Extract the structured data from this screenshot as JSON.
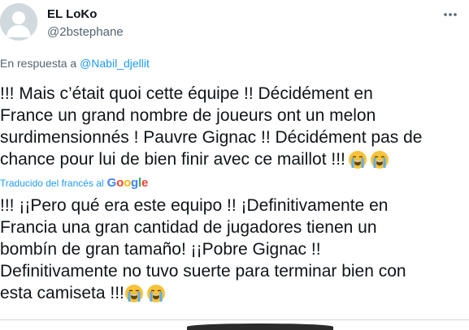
{
  "author": {
    "name": "EL LoKo",
    "handle": "@2bstephane"
  },
  "reply": {
    "prefix": "En respuesta a",
    "mention": "@Nabil_djellit"
  },
  "tweet": {
    "lines": [
      "!!! Mais c’était quoi cette équipe !! Décidément en",
      "France un grand nombre de joueurs ont un melon",
      "surdimensionnés ! Pauvre Gignac !! Décidément pas de",
      "chance pour lui de bien finir avec ce maillot !!!"
    ]
  },
  "translation": {
    "credit": "Traducido del francés al",
    "provider": "Google",
    "lines": [
      "!!! ¡¡Pero qué era este equipo !! ¡Definitivamente en",
      "Francia una gran cantidad de jugadores tienen un",
      "bombín de gran tamaño! ¡¡Pobre Gignac !!",
      "Definitivamente no tuvo suerte para terminar bien con",
      "esta camiseta !!!"
    ]
  },
  "icons": {
    "more": "more-horizontal-icon",
    "emoji": "loudly-crying-face-icon"
  },
  "colors": {
    "link": "#1d9bf0",
    "secondary_text": "#536471",
    "primary_text": "#0f1419"
  }
}
